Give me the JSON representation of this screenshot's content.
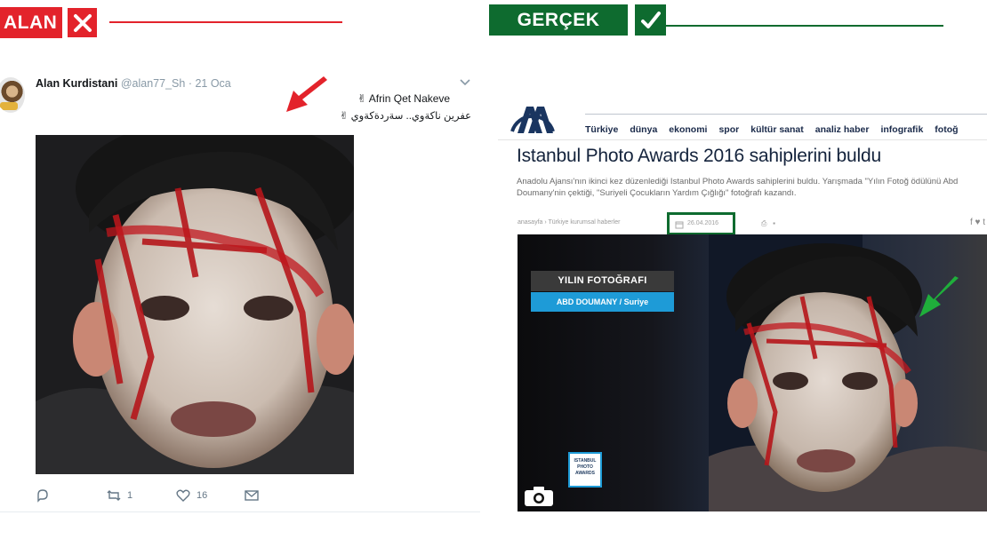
{
  "banners": {
    "false_label": "ALAN",
    "true_label": "GERÇEK",
    "false_color": "#e3232b",
    "true_color": "#0e6b2f"
  },
  "tweet": {
    "name": "Alan Kurdistani",
    "handle": "@alan77_Sh",
    "date": "· 21 Oca",
    "text_line1": "✌ Afrin Qet Nakeve",
    "text_line2": "عفرين ناكةوي.. سةردةكةوي ✌",
    "actions": {
      "reply_count": "",
      "retweet_count": "1",
      "like_count": "16"
    }
  },
  "news": {
    "logo": "AA",
    "nav": [
      "Türkiye",
      "dünya",
      "ekonomi",
      "spor",
      "kültür sanat",
      "analiz haber",
      "infografik",
      "fotoğ"
    ],
    "title": "Istanbul Photo Awards 2016 sahiplerini buldu",
    "lead": "Anadolu Ajansı'nın ikinci kez düzenlediği Istanbul Photo Awards sahiplerini buldu. Yarışmada \"Yılın Fotoğ ödülünü Abd Doumany'nin çektiği, \"Suriyeli Çocukların Yardım Çığlığı\" fotoğrafı kazandı.",
    "breadcrumb": "anasayfa › Türkiye kurumsal haberler",
    "date": "26.04.2016",
    "share_icons": "f  ♥  t",
    "photo_label_title": "YILIN FOTOĞRAFI",
    "photo_label_credit": "ABD DOUMANY / Suriye",
    "award_logo": "ISTANBUL PHOTO AWARDS"
  }
}
